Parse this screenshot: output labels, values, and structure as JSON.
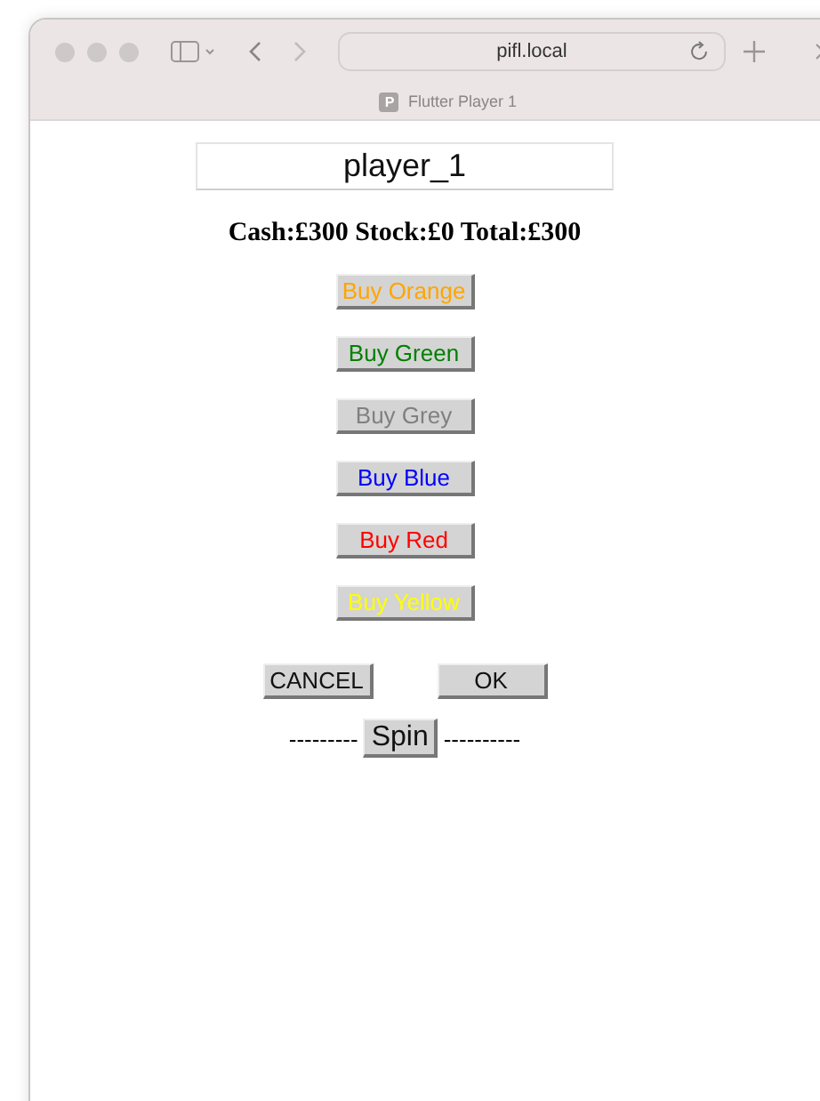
{
  "browser": {
    "address": "pifl.local",
    "tab": {
      "icon_letter": "P",
      "title": "Flutter Player 1"
    }
  },
  "player": {
    "value": "player_1"
  },
  "stats": "Cash:£300 Stock:£0 Total:£300",
  "buy_buttons": [
    {
      "label": "Buy Orange",
      "color": "#ffa500"
    },
    {
      "label": "Buy Green",
      "color": "#008000"
    },
    {
      "label": "Buy Grey",
      "color": "#808080"
    },
    {
      "label": "Buy Blue",
      "color": "#0000ff"
    },
    {
      "label": "Buy Red",
      "color": "#ff0000"
    },
    {
      "label": "Buy Yellow",
      "color": "#ffff00"
    }
  ],
  "actions": [
    "CANCEL",
    "OK"
  ],
  "spin": {
    "left": "---------",
    "label": "Spin",
    "right": "----------"
  }
}
